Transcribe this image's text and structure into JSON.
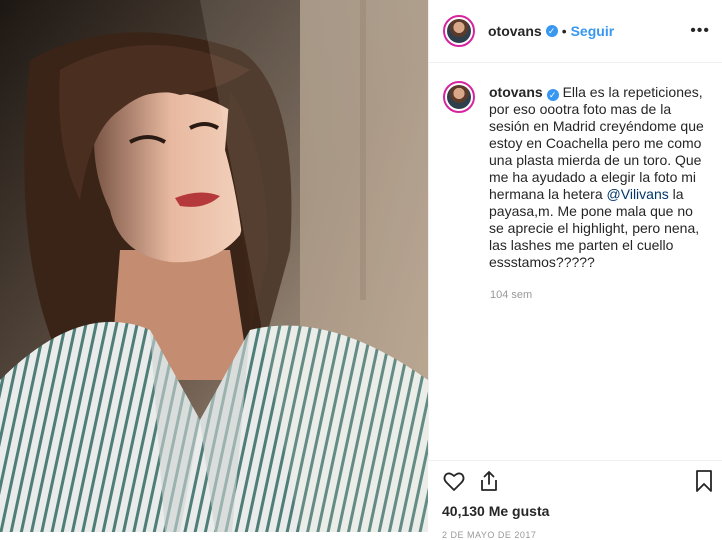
{
  "post": {
    "username": "otovans",
    "verified_icon": "verified-badge-icon",
    "separator": "•",
    "follow_label": "Seguir",
    "more_label": "•••"
  },
  "caption": {
    "username": "otovans",
    "text_before": " Ella es la repeticiones, por eso oootra foto mas de la sesión en Madrid creyéndome que estoy en Coachella pero me como una plasta mierda de un toro. Que me ha ayudado a elegir la foto mi hermana la hetera ",
    "mention": "@Vilivans",
    "text_after": " la payasa,m. Me pone mala que no se aprecie el highlight, pero nena, las lashes me parten el cuello essstamos?????",
    "time": "104 sem"
  },
  "actions": {
    "likes": "40,130 Me gusta",
    "date": "2 DE MAYO DE 2017"
  },
  "colors": {
    "accent": "#3897f0",
    "text": "#262626",
    "muted": "#999999"
  }
}
